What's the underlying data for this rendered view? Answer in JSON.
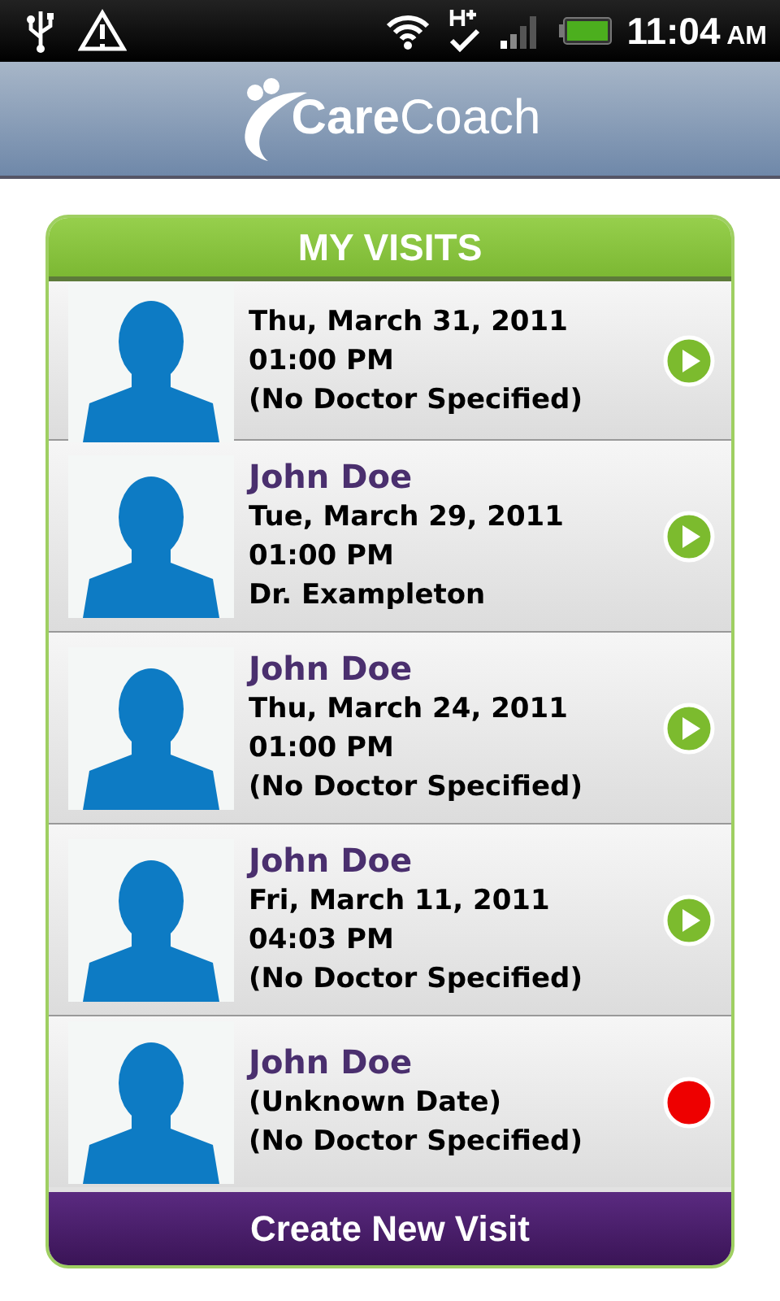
{
  "status_bar": {
    "time": "11:04",
    "meridiem": "AM"
  },
  "header": {
    "logo_text_bold": "Care",
    "logo_text": "Coach"
  },
  "visits_panel": {
    "title": "MY VISITS",
    "visits": [
      {
        "date": "Thu, March 31, 2011",
        "time": "01:00 PM",
        "doctor": "(No Doctor Specified)",
        "kind": "scheduled"
      },
      {
        "patient": "John Doe",
        "date": "Tue, March 29, 2011",
        "time": "01:00 PM",
        "doctor": "Dr. Exampleton",
        "kind": "scheduled"
      },
      {
        "patient": "John Doe",
        "date": "Thu, March 24, 2011",
        "time": "01:00 PM",
        "doctor": "(No Doctor Specified)",
        "kind": "scheduled"
      },
      {
        "patient": "John Doe",
        "date": "Fri, March 11, 2011",
        "time": "04:03 PM",
        "doctor": "(No Doctor Specified)",
        "kind": "scheduled"
      },
      {
        "patient": "John Doe",
        "date": "(Unknown Date)",
        "doctor": "(No Doctor Specified)",
        "kind": "incomplete"
      }
    ],
    "button": "Create New Visit"
  }
}
